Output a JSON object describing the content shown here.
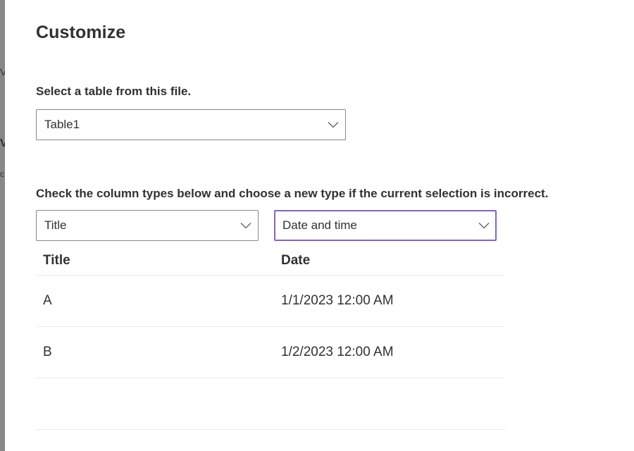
{
  "background": {
    "glyphs": [
      "V",
      "V",
      "c"
    ]
  },
  "dialog": {
    "title": "Customize",
    "table_select_label": "Select a table from this file.",
    "table_select_value": "Table1",
    "column_types_label": "Check the column types below and choose a new type if the current selection is incorrect.",
    "column_type_selects": [
      {
        "value": "Title"
      },
      {
        "value": "Date and time"
      }
    ],
    "preview": {
      "columns": [
        "Title",
        "Date"
      ],
      "rows": [
        [
          "A",
          "1/1/2023 12:00 AM"
        ],
        [
          "B",
          "1/2/2023 12:00 AM"
        ]
      ]
    }
  },
  "colors": {
    "focus_border": "#8764b8",
    "border": "#8a8886",
    "divider": "#edebe9",
    "text": "#323130"
  },
  "icons": {
    "dropdown": "chevron-down-icon"
  }
}
